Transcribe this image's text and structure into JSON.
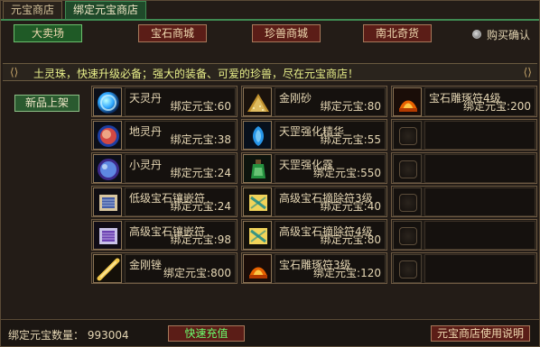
{
  "tabs": [
    {
      "label": "元宝商店"
    },
    {
      "label": "绑定元宝商店"
    }
  ],
  "categories": [
    {
      "label": "大卖场"
    },
    {
      "label": "宝石商城"
    },
    {
      "label": "珍兽商城"
    },
    {
      "label": "南北奇货"
    }
  ],
  "confirm_label": "购买确认",
  "banner_text": "土灵珠，快速升级必备；强大的装备、可爱的珍兽，尽在元宝商店！",
  "new_label": "新品上架",
  "currency_label": "绑定元宝",
  "items": [
    {
      "name": "天灵丹",
      "price": "绑定元宝:60",
      "icon": "blue-orb-icon"
    },
    {
      "name": "金刚砂",
      "price": "绑定元宝:80",
      "icon": "gold-sand-icon"
    },
    {
      "name": "宝石雕琢符4级",
      "price": "绑定元宝:200",
      "icon": "fire-talisman-icon"
    },
    {
      "name": "地灵丹",
      "price": "绑定元宝:38",
      "icon": "red-blue-orb-icon"
    },
    {
      "name": "天罡强化精华",
      "price": "绑定元宝:55",
      "icon": "blue-essence-icon"
    },
    {
      "name": "",
      "price": "",
      "icon": "empty-slot-icon"
    },
    {
      "name": "小灵丹",
      "price": "绑定元宝:24",
      "icon": "purple-orb-icon"
    },
    {
      "name": "天罡强化露",
      "price": "绑定元宝:550",
      "icon": "green-potion-icon"
    },
    {
      "name": "",
      "price": "",
      "icon": "empty-slot-icon"
    },
    {
      "name": "低级宝石镶嵌符",
      "price": "绑定元宝:24",
      "icon": "scroll-icon"
    },
    {
      "name": "高级宝石摘除符3级",
      "price": "绑定元宝:40",
      "icon": "yellow-scroll-icon"
    },
    {
      "name": "",
      "price": "",
      "icon": "empty-slot-icon"
    },
    {
      "name": "高级宝石镶嵌符",
      "price": "绑定元宝:98",
      "icon": "purple-scroll-icon"
    },
    {
      "name": "高级宝石摘除符4级",
      "price": "绑定元宝:80",
      "icon": "yellow-scroll-icon"
    },
    {
      "name": "",
      "price": "",
      "icon": "empty-slot-icon"
    },
    {
      "name": "金刚锉",
      "price": "绑定元宝:800",
      "icon": "gold-file-icon"
    },
    {
      "name": "宝石雕琢符3级",
      "price": "绑定元宝:120",
      "icon": "fire-talisman-icon"
    },
    {
      "name": "",
      "price": "",
      "icon": "empty-slot-icon"
    }
  ],
  "bottom": {
    "balance_label": "绑定元宝数量：",
    "balance_value": "993004",
    "charge_label": "快速充值",
    "help_label": "元宝商店使用说明"
  }
}
